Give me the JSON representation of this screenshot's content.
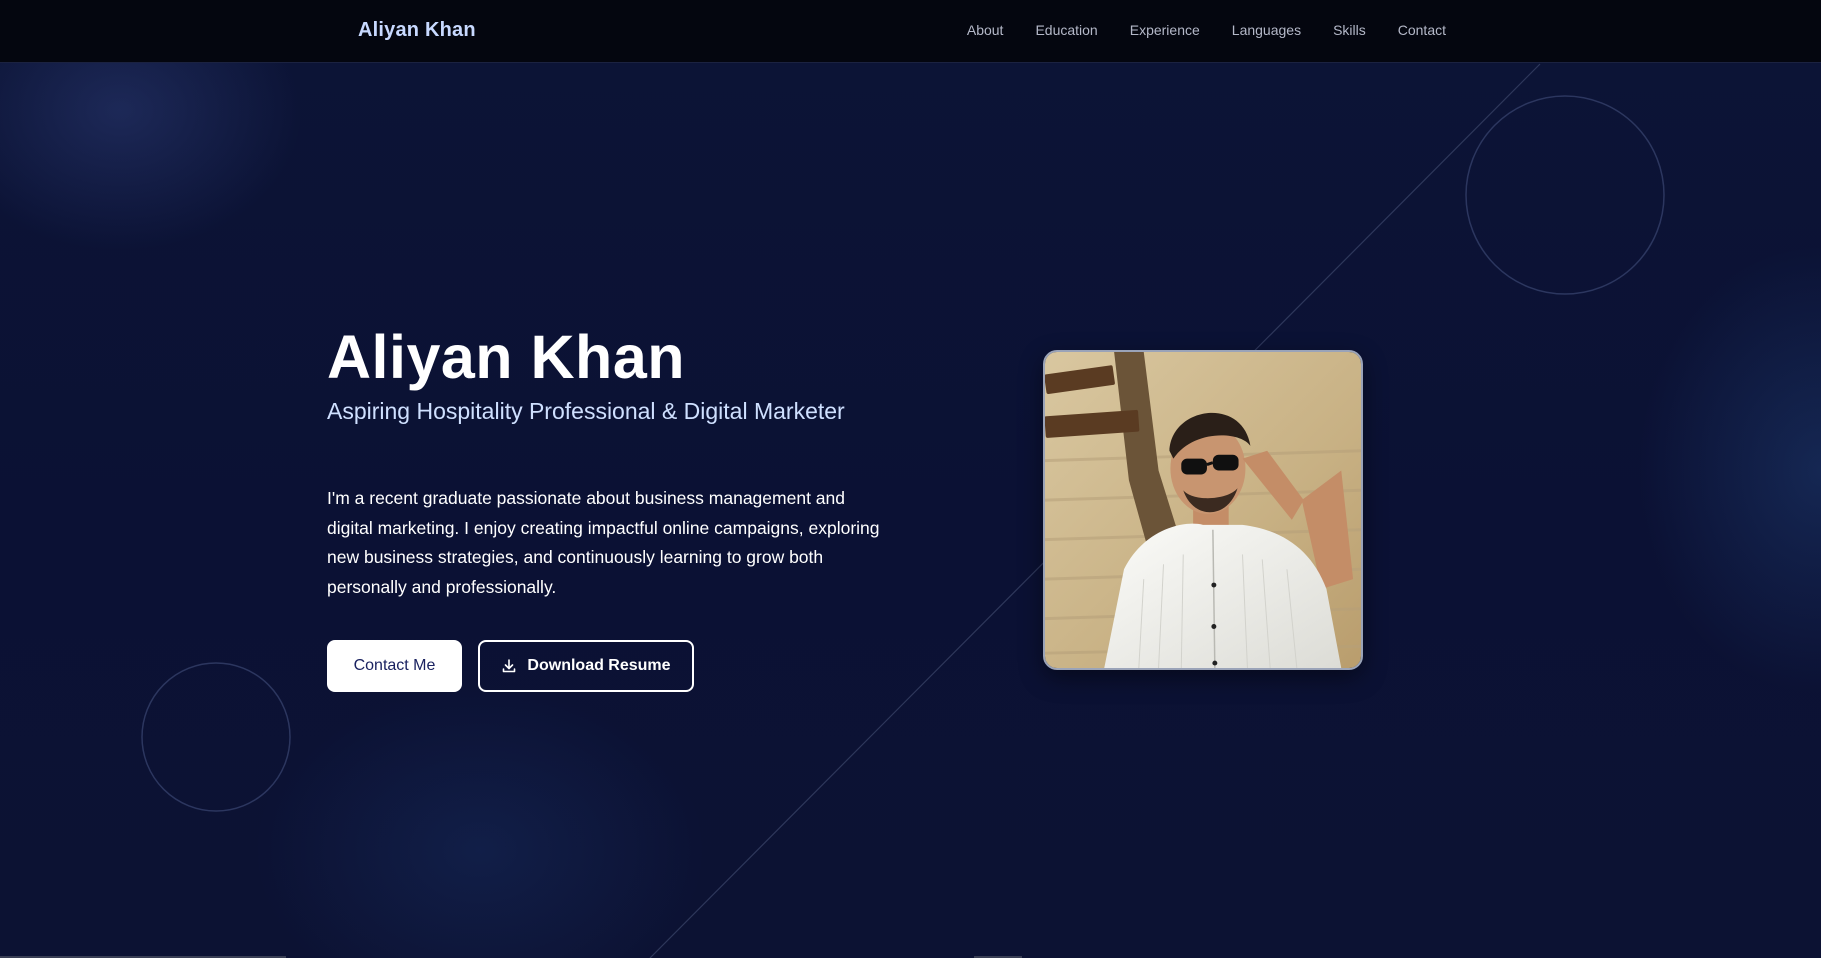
{
  "header": {
    "brand": "Aliyan Khan",
    "nav": [
      {
        "label": "About"
      },
      {
        "label": "Education"
      },
      {
        "label": "Experience"
      },
      {
        "label": "Languages"
      },
      {
        "label": "Skills"
      },
      {
        "label": "Contact"
      }
    ]
  },
  "hero": {
    "title": "Aliyan Khan",
    "subtitle": "Aspiring Hospitality Professional & Digital Marketer",
    "description": "I'm a recent graduate passionate about business management and digital marketing. I enjoy creating impactful online campaigns, exploring new business strategies, and continuously learning to grow both personally and professionally.",
    "contact_button": "Contact Me",
    "resume_button": "Download Resume",
    "resume_icon": "download-icon",
    "photo_alt": "Aliyan Khan"
  },
  "colors": {
    "background": "#0b1134",
    "nav_background": "#04060f",
    "brand": "#c8d9ff",
    "subtitle": "#cfe0ff",
    "button_text": "#1a2260"
  }
}
